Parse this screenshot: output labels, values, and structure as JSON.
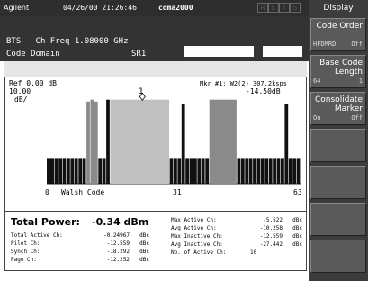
{
  "topbar": {
    "logo": "Agilent",
    "datetime": "04/26/00 21:26:46",
    "standard": "cdma2000",
    "indicators": [
      "R",
      "L",
      "T",
      "S"
    ]
  },
  "header": {
    "line1_label": "BTS",
    "line1_value": "Ch Freq 1.08000 GHz",
    "line2_label": "Code Domain",
    "line2_value": "SR1"
  },
  "plot": {
    "ref": "Ref 0.00 dB",
    "scale1": "10.00",
    "scale2": "dB/",
    "marker_text": "Mkr #1: W2(2) 307.2ksps",
    "marker_value": "-14.50dB",
    "marker_num": "1",
    "x_start": "0",
    "x_label": "Walsh Code",
    "x_mid": "31",
    "x_end": "63"
  },
  "chart_data": {
    "type": "bar",
    "title": "",
    "xlabel": "Walsh Code",
    "ylabel": "dB",
    "ylim": [
      -100,
      0
    ],
    "x_ticks": [
      "0",
      "31",
      "63"
    ],
    "bars": [
      {
        "start": 0,
        "end": 2,
        "value": -73,
        "color": "#111111"
      },
      {
        "start": 2,
        "end": 3,
        "value": -73,
        "color": "#111111"
      },
      {
        "start": 3,
        "end": 4,
        "value": -73,
        "color": "#111111"
      },
      {
        "start": 4,
        "end": 5,
        "value": -73,
        "color": "#111111"
      },
      {
        "start": 5,
        "end": 6,
        "value": -73,
        "color": "#111111"
      },
      {
        "start": 6,
        "end": 7,
        "value": -73,
        "color": "#111111"
      },
      {
        "start": 7,
        "end": 8,
        "value": -73,
        "color": "#111111"
      },
      {
        "start": 8,
        "end": 9,
        "value": -73,
        "color": "#111111"
      },
      {
        "start": 9,
        "end": 10,
        "value": -73,
        "color": "#111111"
      },
      {
        "start": 10,
        "end": 11,
        "value": -14,
        "color": "#8a8a8a"
      },
      {
        "start": 11,
        "end": 12,
        "value": -12,
        "color": "#8a8a8a"
      },
      {
        "start": 12,
        "end": 13,
        "value": -14,
        "color": "#8a8a8a"
      },
      {
        "start": 13,
        "end": 14,
        "value": -73,
        "color": "#111111"
      },
      {
        "start": 14,
        "end": 15,
        "value": -73,
        "color": "#111111"
      },
      {
        "start": 15,
        "end": 16,
        "value": -12,
        "color": "#111111"
      },
      {
        "start": 16,
        "end": 31,
        "value": -12,
        "color": "#c0c0c0"
      },
      {
        "start": 31,
        "end": 32,
        "value": -73,
        "color": "#111111"
      },
      {
        "start": 32,
        "end": 33,
        "value": -73,
        "color": "#111111"
      },
      {
        "start": 33,
        "end": 34,
        "value": -73,
        "color": "#111111"
      },
      {
        "start": 34,
        "end": 35,
        "value": -16,
        "color": "#111111"
      },
      {
        "start": 35,
        "end": 36,
        "value": -73,
        "color": "#111111"
      },
      {
        "start": 36,
        "end": 37,
        "value": -73,
        "color": "#111111"
      },
      {
        "start": 37,
        "end": 38,
        "value": -73,
        "color": "#111111"
      },
      {
        "start": 38,
        "end": 39,
        "value": -73,
        "color": "#111111"
      },
      {
        "start": 39,
        "end": 40,
        "value": -73,
        "color": "#111111"
      },
      {
        "start": 40,
        "end": 41,
        "value": -73,
        "color": "#111111"
      },
      {
        "start": 41,
        "end": 48,
        "value": -12,
        "color": "#8a8a8a"
      },
      {
        "start": 48,
        "end": 49,
        "value": -73,
        "color": "#111111"
      },
      {
        "start": 49,
        "end": 50,
        "value": -73,
        "color": "#111111"
      },
      {
        "start": 50,
        "end": 51,
        "value": -73,
        "color": "#111111"
      },
      {
        "start": 51,
        "end": 52,
        "value": -73,
        "color": "#111111"
      },
      {
        "start": 52,
        "end": 53,
        "value": -73,
        "color": "#111111"
      },
      {
        "start": 53,
        "end": 54,
        "value": -73,
        "color": "#111111"
      },
      {
        "start": 54,
        "end": 55,
        "value": -73,
        "color": "#111111"
      },
      {
        "start": 55,
        "end": 56,
        "value": -73,
        "color": "#111111"
      },
      {
        "start": 56,
        "end": 57,
        "value": -73,
        "color": "#111111"
      },
      {
        "start": 57,
        "end": 58,
        "value": -73,
        "color": "#111111"
      },
      {
        "start": 58,
        "end": 59,
        "value": -73,
        "color": "#111111"
      },
      {
        "start": 59,
        "end": 60,
        "value": -73,
        "color": "#111111"
      },
      {
        "start": 60,
        "end": 61,
        "value": -16,
        "color": "#111111"
      },
      {
        "start": 61,
        "end": 62,
        "value": -73,
        "color": "#111111"
      },
      {
        "start": 62,
        "end": 63,
        "value": -73,
        "color": "#111111"
      },
      {
        "start": 63,
        "end": 64,
        "value": -73,
        "color": "#111111"
      }
    ],
    "marker": {
      "x": 15,
      "value": -14.5
    }
  },
  "results": {
    "total_power_label": "Total Power:",
    "total_power_value": "-0.34 dBm",
    "left": [
      {
        "label": "Total Active Ch:",
        "value": "-0.24967",
        "unit": "dBc"
      },
      {
        "label": "Pilot Ch:",
        "value": "-12.559",
        "unit": "dBc"
      },
      {
        "label": "Synch Ch:",
        "value": "-18.292",
        "unit": "dBc"
      },
      {
        "label": "Page Ch:",
        "value": "-12.252",
        "unit": "dBc"
      }
    ],
    "right": [
      {
        "label": "Max Active Ch:",
        "value": "-5.522",
        "unit": "dBc"
      },
      {
        "label": "Avg Active Ch:",
        "value": "-10.258",
        "unit": "dBc"
      },
      {
        "label": "Max Inactive Ch:",
        "value": "-12.559",
        "unit": "dBc"
      },
      {
        "label": "Avg Inactive Ch:",
        "value": "-27.442",
        "unit": "dBc"
      },
      {
        "label": "No. of Active Ch:",
        "value": "10",
        "unit": ""
      }
    ]
  },
  "panel": {
    "title": "Display",
    "keys": [
      {
        "label": "Code Order",
        "sub": "HFDMRD",
        "subr": "Off"
      },
      {
        "label": "Base Code Length",
        "sub": "64",
        "subr": "1"
      },
      {
        "label": "Consolidate Marker",
        "sub": "On",
        "subr": "Off"
      },
      {
        "label": "",
        "sub": "",
        "subr": ""
      },
      {
        "label": "",
        "sub": "",
        "subr": ""
      },
      {
        "label": "",
        "sub": "",
        "subr": ""
      },
      {
        "label": "",
        "sub": "",
        "subr": ""
      }
    ]
  }
}
